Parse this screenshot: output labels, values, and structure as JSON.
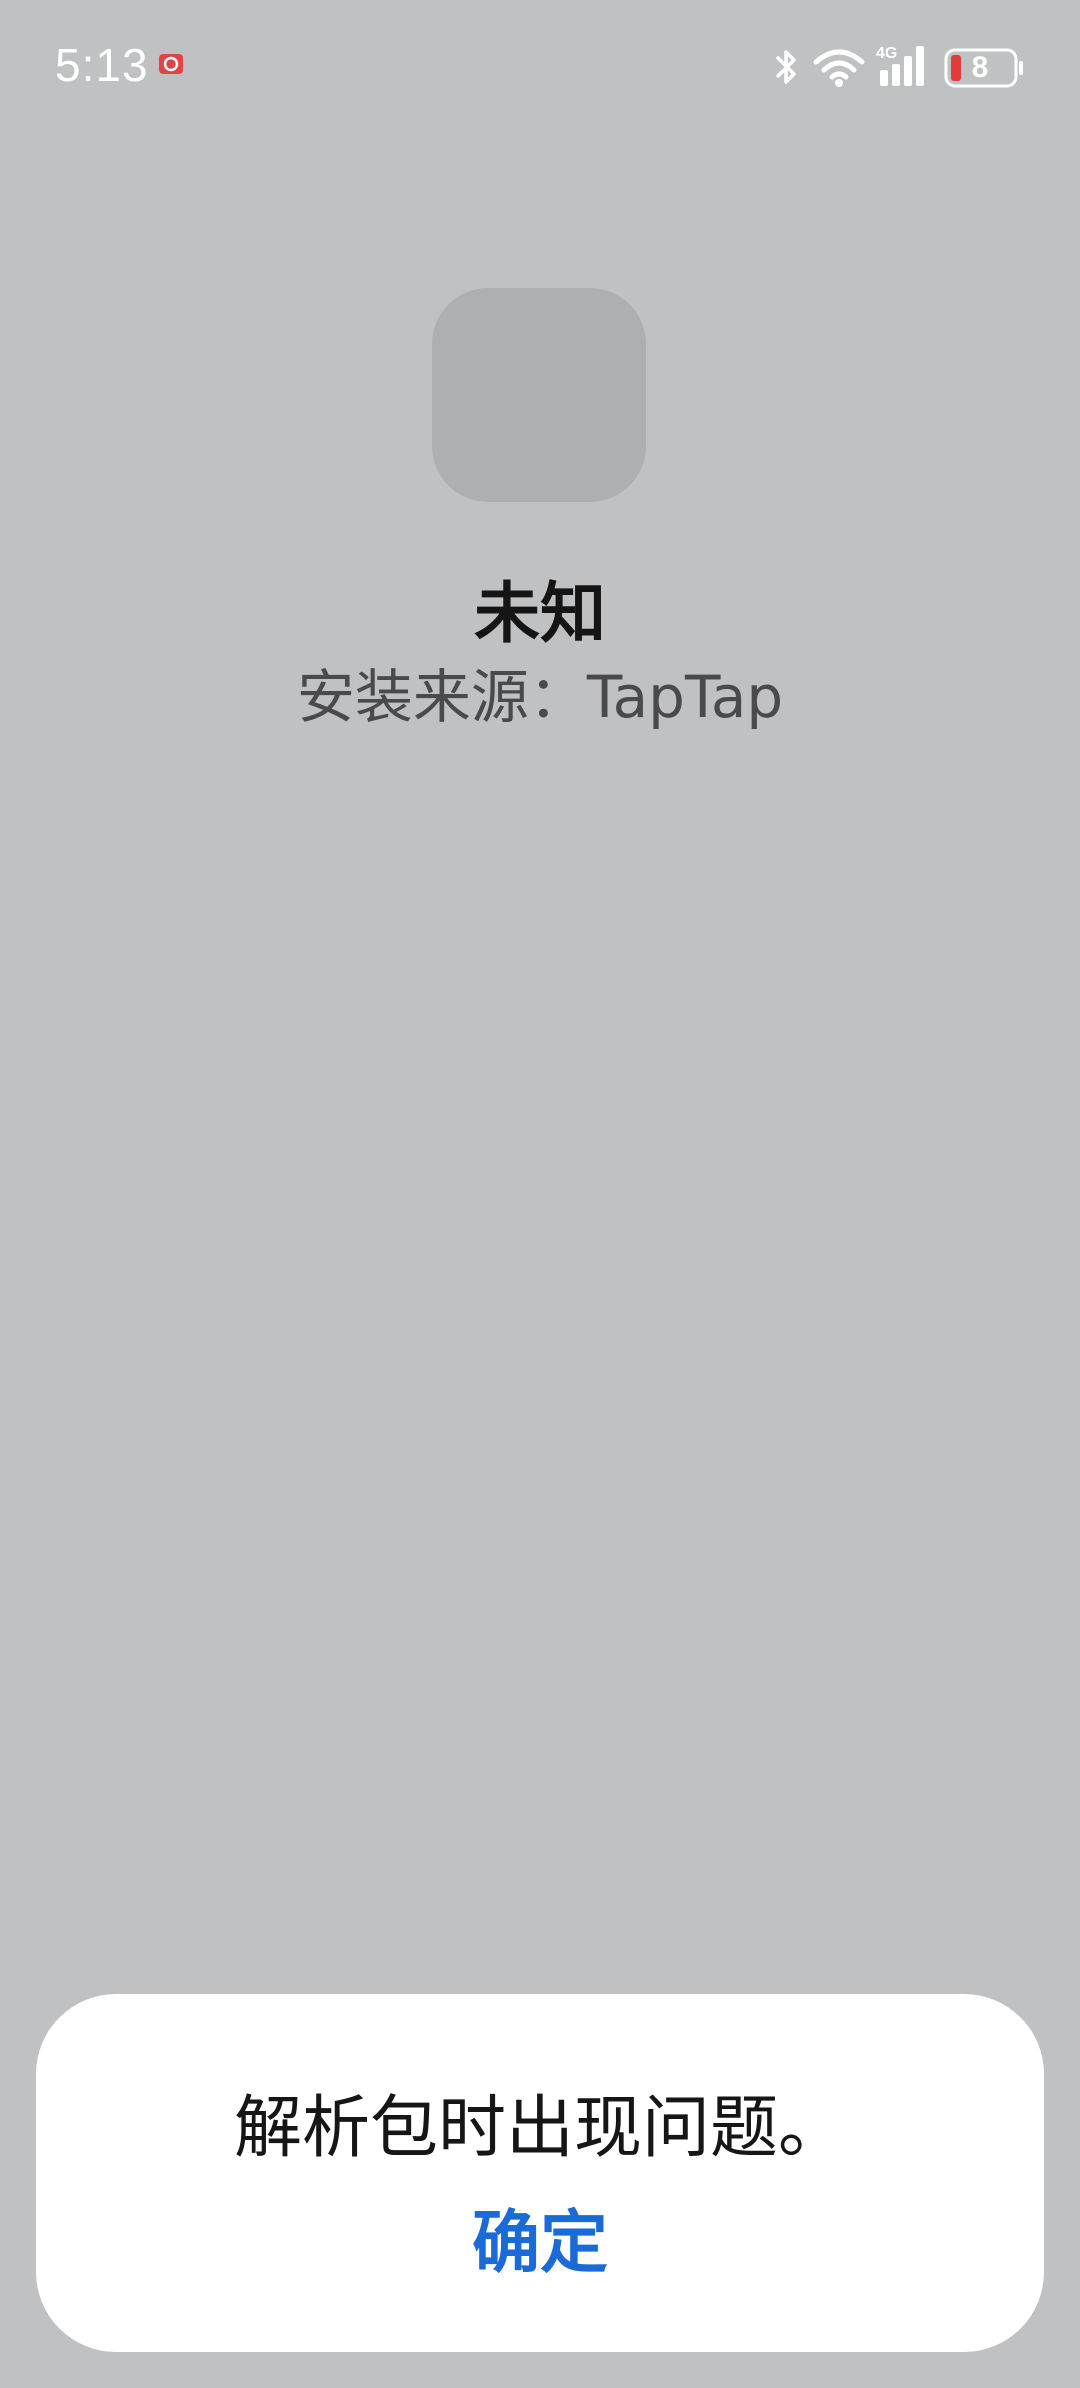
{
  "status_bar": {
    "time": "5:13",
    "battery_level": "8",
    "icons": [
      "alarm-icon",
      "bluetooth-icon",
      "wifi-icon",
      "signal-4g-icon",
      "battery-icon"
    ],
    "network_label": "4G"
  },
  "app": {
    "name": "未知",
    "install_source": "安装来源：TapTap"
  },
  "dialog": {
    "message": "解析包时出现问题。",
    "confirm_label": "确定"
  },
  "colors": {
    "background": "#c0c1c3",
    "icon_placeholder": "#aeafb1",
    "accent": "#1a6ad8",
    "battery_low": "#e33b3b"
  }
}
